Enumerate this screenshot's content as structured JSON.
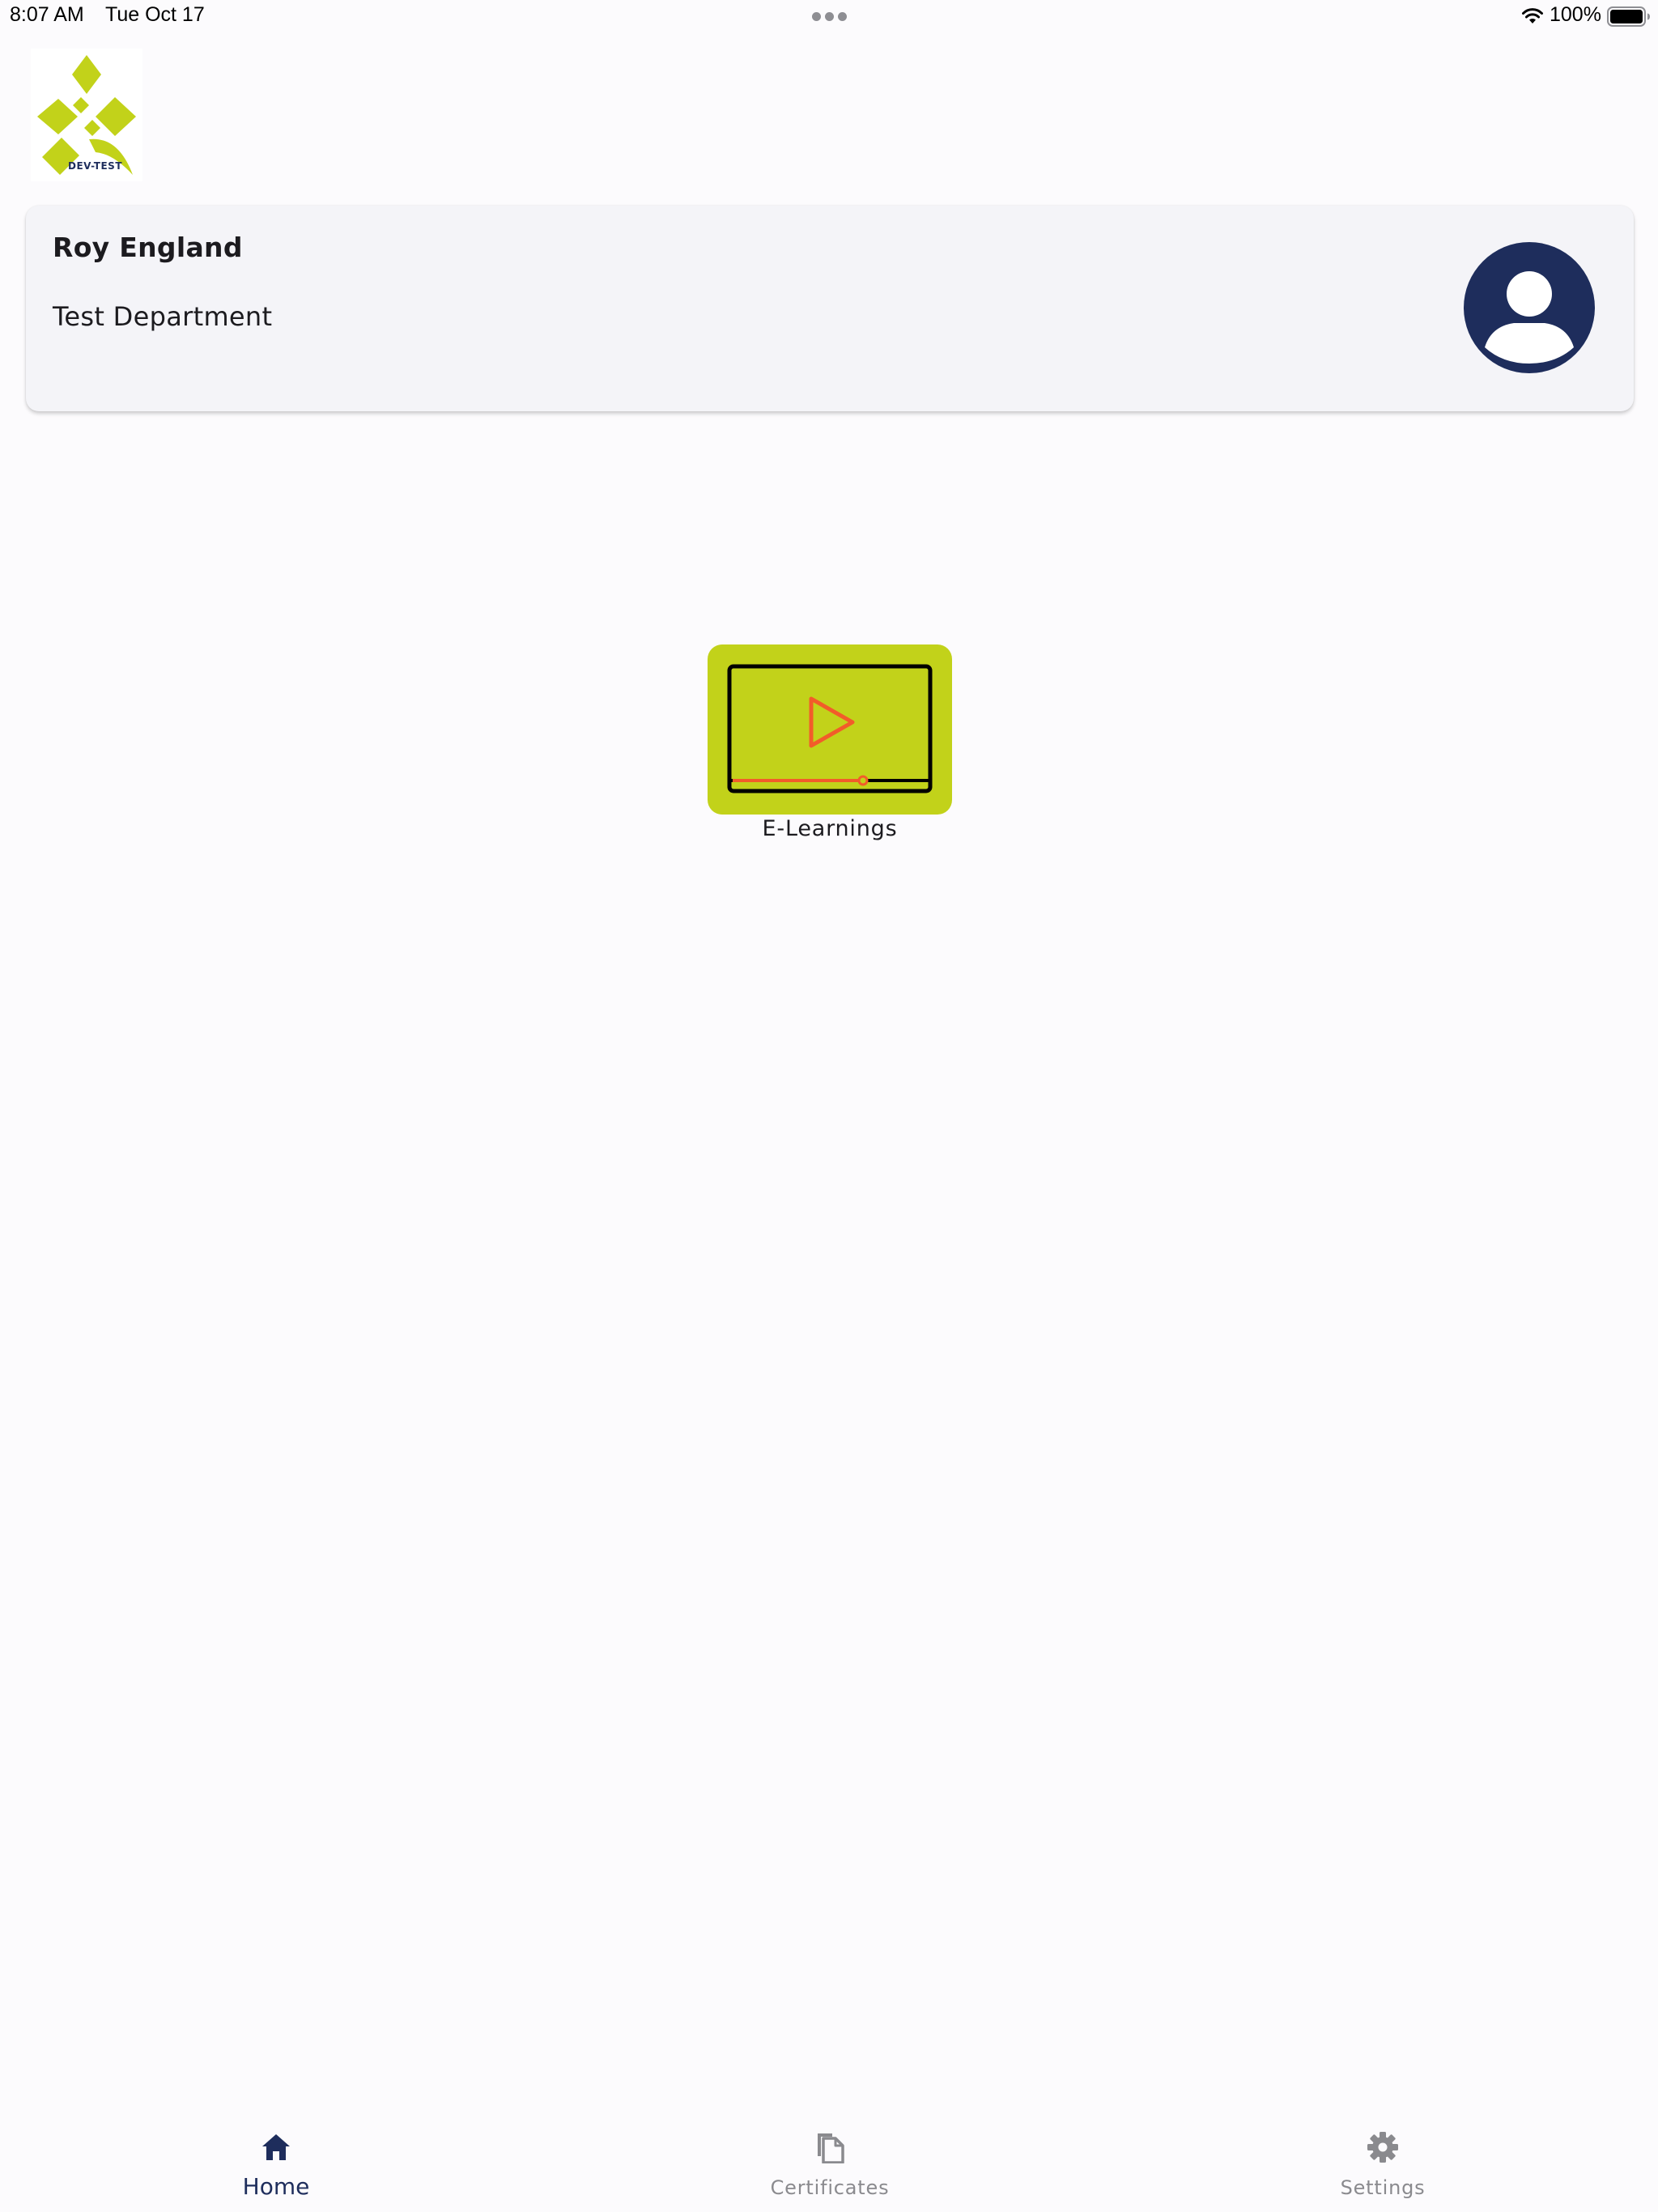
{
  "status_bar": {
    "time": "8:07 AM",
    "date": "Tue Oct 17",
    "battery_percent": "100%",
    "battery_level": 1.0,
    "icons": [
      "wifi-icon",
      "battery-icon",
      "multitask-dots-icon"
    ]
  },
  "logo": {
    "text": "DEV-TEST",
    "icon": "star-logo-icon",
    "color": "#c2d21a"
  },
  "profile": {
    "name": "Roy England",
    "department": "Test Department",
    "avatar_icon": "user-avatar-icon",
    "avatar_color": "#1e2d5c"
  },
  "tiles": [
    {
      "label": "E-Learnings",
      "icon": "video-player-icon",
      "background": "#c2d21a",
      "accent": "#f25c2a"
    }
  ],
  "bottom_nav": {
    "items": [
      {
        "label": "Home",
        "icon": "home-icon",
        "active": true
      },
      {
        "label": "Certificates",
        "icon": "certificates-icon",
        "active": false
      },
      {
        "label": "Settings",
        "icon": "gear-icon",
        "active": false
      }
    ],
    "active_color": "#1e2d5c",
    "inactive_color": "#8a8a8e"
  }
}
